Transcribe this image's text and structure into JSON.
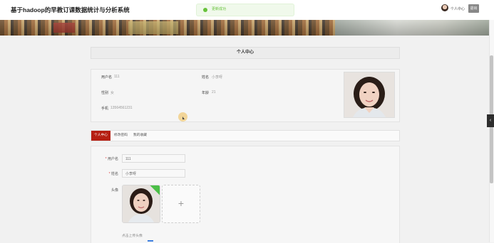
{
  "header": {
    "app_title": "基于hadoop的早教订课数据统计与分析系统",
    "toast_text": "更新成功",
    "user_center_link": "个人中心",
    "logout_label": "退出"
  },
  "panel": {
    "title": "个人中心"
  },
  "profile": {
    "username_label": "用户名",
    "username_value": "111",
    "name_label": "姓名",
    "name_value": "小李呀",
    "gender_label": "性别",
    "gender_value": "女",
    "age_label": "年龄",
    "age_value": "21",
    "phone_label": "手机",
    "phone_value": "13564561231"
  },
  "tabs": [
    {
      "label": "个人中心",
      "active": true
    },
    {
      "label": "修改密码",
      "active": false
    },
    {
      "label": "我的收藏",
      "active": false
    }
  ],
  "form": {
    "username_label": "用户名",
    "username_value": "111",
    "name_label": "姓名",
    "name_value": "小李呀",
    "avatar_label": "头像",
    "upload_plus": "+",
    "upload_hint": "点击上传头像"
  },
  "colors": {
    "tab_active": "#b51f12",
    "toast_success": "#67c23a"
  },
  "icons": {
    "toast": "success-dot-icon",
    "upload": "plus-icon",
    "side_handle": "chevron-left-icon"
  }
}
